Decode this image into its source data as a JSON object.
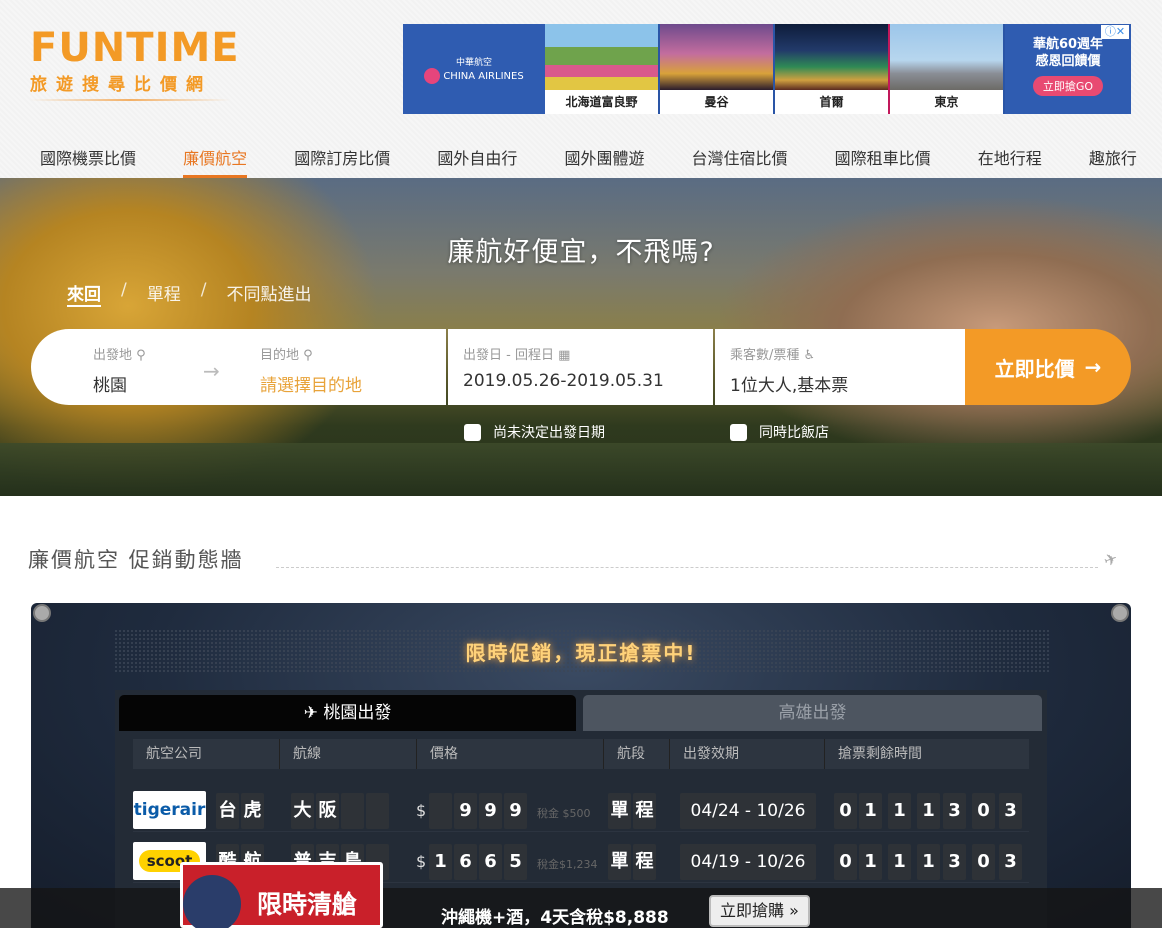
{
  "logo": {
    "name": "FUNTIME",
    "tagline": "旅遊搜尋比價網"
  },
  "ad": {
    "brand_cn": "中華航空",
    "brand_en": "CHINA AIRLINES",
    "tiles": [
      "北海道富良野",
      "曼谷",
      "首爾",
      "東京"
    ],
    "promo_line1": "華航60週年",
    "promo_line2": "感恩回饋價",
    "promo_button": "立即搶GO"
  },
  "nav": {
    "items": [
      "國際機票比價",
      "廉價航空",
      "國際訂房比價",
      "國外自由行",
      "國外團體遊",
      "台灣住宿比價",
      "國際租車比價",
      "在地行程",
      "趣旅行"
    ],
    "active_index": 1
  },
  "hero": {
    "title": "廉航好便宜，不飛嗎?",
    "trip_types": [
      "來回",
      "單程",
      "不同點進出"
    ],
    "search": {
      "origin_label": "出發地",
      "origin_value": "桃園",
      "dest_label": "目的地",
      "dest_placeholder": "請選擇目的地",
      "date_label": "出發日 - 回程日",
      "date_value": "2019.05.26-2019.05.31",
      "pax_label": "乘客數/票種",
      "pax_value": "1位大人,基本票",
      "submit": "立即比價"
    },
    "checks": [
      "尚未決定出發日期",
      "同時比飯店"
    ]
  },
  "section_title": "廉價航空 促銷動態牆",
  "board": {
    "title": "限時促銷，現正搶票中!",
    "tabs": [
      "桃園出發",
      "高雄出發"
    ],
    "headers": [
      "航空公司",
      "航線",
      "價格",
      "航段",
      "出發效期",
      "搶票剩餘時間"
    ],
    "rows": [
      {
        "logo": "tigerair",
        "airline": [
          "台",
          "虎"
        ],
        "route": [
          "大",
          "阪"
        ],
        "price": [
          "",
          "9",
          "9",
          "9"
        ],
        "tax": "稅金 $500",
        "leg": [
          "單",
          "程"
        ],
        "range": "04/24 - 10/26",
        "countdown": [
          "0",
          "1",
          "1",
          "1",
          "3",
          "0",
          "3"
        ]
      },
      {
        "logo": "scoot",
        "airline": [
          "酷",
          "航"
        ],
        "route": [
          "普",
          "吉",
          "島"
        ],
        "price": [
          "1",
          "6",
          "6",
          "5"
        ],
        "tax": "稅金$1,234",
        "leg": [
          "單",
          "程"
        ],
        "range": "04/19 - 10/26",
        "countdown": [
          "0",
          "1",
          "1",
          "1",
          "3",
          "0",
          "3"
        ]
      }
    ]
  },
  "bottom_banner": {
    "badge": "限時清艙",
    "text": "沖繩機+酒，4天含稅$8,888",
    "button": "立即搶購 »"
  }
}
